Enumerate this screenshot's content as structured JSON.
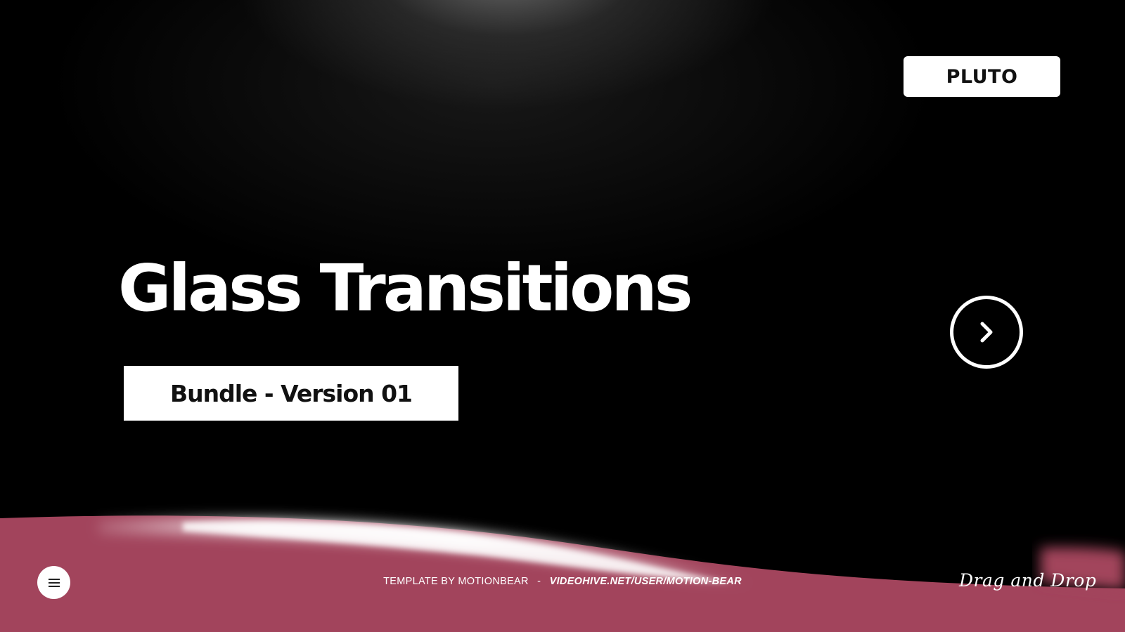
{
  "brand": {
    "label": "PLUTO"
  },
  "hero": {
    "title": "Glass Transitions",
    "subtitle": "Bundle - Version 01"
  },
  "navigation": {
    "next_icon": "chevron-right-icon",
    "menu_icon": "hamburger-menu-icon"
  },
  "footer": {
    "credit_text": "TEMPLATE BY MOTIONBEAR",
    "separator": "-",
    "url": "VIDEOHIVE.NET/USER/MOTION-BEAR",
    "tagline": "Drag and Drop"
  },
  "colors": {
    "background": "#000000",
    "accent_wave": "#a2445c",
    "foreground": "#ffffff",
    "text_dark": "#111111"
  }
}
